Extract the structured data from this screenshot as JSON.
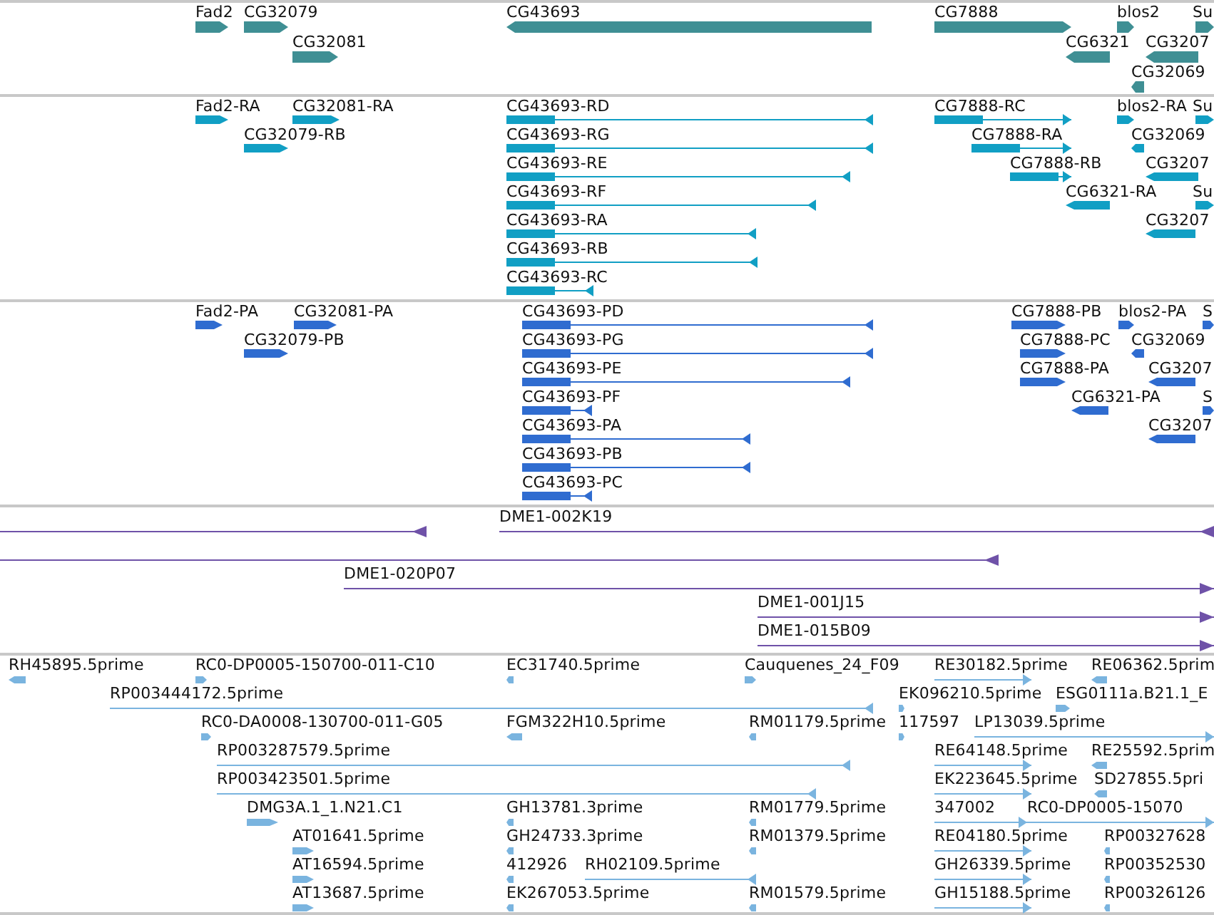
{
  "tracks": [
    {
      "kind": "gene",
      "features": [
        {
          "label": "Fad2",
          "reverse_strand": false
        },
        {
          "label": "CG32079",
          "reverse_strand": false
        },
        {
          "label": "CG32081",
          "reverse_strand": false
        },
        {
          "label": "CG43693",
          "reverse_strand": true
        },
        {
          "label": "CG7888",
          "reverse_strand": false
        },
        {
          "label": "blos2",
          "reverse_strand": false
        },
        {
          "label": "Su",
          "reverse_strand": false
        },
        {
          "label": "CG6321",
          "reverse_strand": true
        },
        {
          "label": "CG3207",
          "reverse_strand": true
        },
        {
          "label": "CG32069",
          "reverse_strand": true
        }
      ]
    },
    {
      "kind": "transcript",
      "features": [
        {
          "label": "Fad2-RA",
          "reverse_strand": false
        },
        {
          "label": "CG32081-RA",
          "reverse_strand": false
        },
        {
          "label": "CG32079-RB",
          "reverse_strand": false
        },
        {
          "label": "CG43693-RD",
          "reverse_strand": true
        },
        {
          "label": "CG43693-RG",
          "reverse_strand": true
        },
        {
          "label": "CG43693-RE",
          "reverse_strand": true
        },
        {
          "label": "CG43693-RF",
          "reverse_strand": true
        },
        {
          "label": "CG43693-RA",
          "reverse_strand": true
        },
        {
          "label": "CG43693-RB",
          "reverse_strand": true
        },
        {
          "label": "CG43693-RC",
          "reverse_strand": true
        },
        {
          "label": "CG7888-RC",
          "reverse_strand": false
        },
        {
          "label": "CG7888-RA",
          "reverse_strand": false
        },
        {
          "label": "CG7888-RB",
          "reverse_strand": false
        },
        {
          "label": "CG6321-RA",
          "reverse_strand": true
        },
        {
          "label": "blos2-RA",
          "reverse_strand": false
        },
        {
          "label": "Su",
          "reverse_strand": false
        },
        {
          "label": "CG32069",
          "reverse_strand": true
        },
        {
          "label": "CG3207",
          "reverse_strand": true
        },
        {
          "label": "Su",
          "reverse_strand": false
        },
        {
          "label": "CG3207",
          "reverse_strand": true
        }
      ]
    },
    {
      "kind": "protein",
      "features": [
        {
          "label": "Fad2-PA",
          "reverse_strand": false
        },
        {
          "label": "CG32081-PA",
          "reverse_strand": false
        },
        {
          "label": "CG32079-PB",
          "reverse_strand": false
        },
        {
          "label": "CG43693-PD",
          "reverse_strand": true
        },
        {
          "label": "CG43693-PG",
          "reverse_strand": true
        },
        {
          "label": "CG43693-PE",
          "reverse_strand": true
        },
        {
          "label": "CG43693-PF",
          "reverse_strand": true
        },
        {
          "label": "CG43693-PA",
          "reverse_strand": true
        },
        {
          "label": "CG43693-PB",
          "reverse_strand": true
        },
        {
          "label": "CG43693-PC",
          "reverse_strand": true
        },
        {
          "label": "CG7888-PB",
          "reverse_strand": false
        },
        {
          "label": "blos2-PA",
          "reverse_strand": false
        },
        {
          "label": "S",
          "reverse_strand": false
        },
        {
          "label": "CG7888-PC",
          "reverse_strand": false
        },
        {
          "label": "CG32069",
          "reverse_strand": true
        },
        {
          "label": "CG7888-PA",
          "reverse_strand": false
        },
        {
          "label": "CG3207",
          "reverse_strand": true
        },
        {
          "label": "CG6321-PA",
          "reverse_strand": true
        },
        {
          "label": "S",
          "reverse_strand": false
        },
        {
          "label": "CG3207",
          "reverse_strand": true
        }
      ]
    },
    {
      "kind": "clone",
      "features": [
        {
          "reverse_strand": true
        },
        {
          "label": "DME1-002K19",
          "reverse_strand": true
        },
        {
          "reverse_strand": true
        },
        {
          "label": "DME1-020P07",
          "reverse_strand": false
        },
        {
          "label": "DME1-001J15",
          "reverse_strand": false
        },
        {
          "label": "DME1-015B09",
          "reverse_strand": false
        }
      ]
    },
    {
      "kind": "est",
      "features": [
        {
          "label": "RH45895.5prime",
          "reverse_strand": true
        },
        {
          "label": "RC0-DP0005-150700-011-C10",
          "reverse_strand": false
        },
        {
          "label": "EC31740.5prime",
          "reverse_strand": true
        },
        {
          "label": "Cauquenes_24_F09",
          "reverse_strand": false
        },
        {
          "label": "RE30182.5prime",
          "reverse_strand": false
        },
        {
          "label": "RE06362.5prim",
          "reverse_strand": true
        },
        {
          "label": "RP003444172.5prime",
          "reverse_strand": true
        },
        {
          "label": "EK096210.5prime",
          "reverse_strand": false
        },
        {
          "label": "ESG0111a.B21.1_E",
          "reverse_strand": false
        },
        {
          "label": "RC0-DA0008-130700-011-G05",
          "reverse_strand": false
        },
        {
          "label": "FGM322H10.5prime",
          "reverse_strand": true
        },
        {
          "label": "RM01179.5prime",
          "reverse_strand": true
        },
        {
          "label": "117597",
          "reverse_strand": false
        },
        {
          "label": "LP13039.5prime",
          "reverse_strand": false
        },
        {
          "label": "RP003287579.5prime",
          "reverse_strand": true
        },
        {
          "label": "RE64148.5prime",
          "reverse_strand": false
        },
        {
          "label": "RE25592.5prim",
          "reverse_strand": true
        },
        {
          "label": "RP003423501.5prime",
          "reverse_strand": true
        },
        {
          "label": "EK223645.5prime",
          "reverse_strand": false
        },
        {
          "label": "SD27855.5pri",
          "reverse_strand": true
        },
        {
          "label": "DMG3A.1_1.N21.C1",
          "reverse_strand": false
        },
        {
          "label": "GH13781.3prime",
          "reverse_strand": true
        },
        {
          "label": "RM01779.5prime",
          "reverse_strand": true
        },
        {
          "label": "347002",
          "reverse_strand": false
        },
        {
          "label": "RC0-DP0005-15070",
          "reverse_strand": false
        },
        {
          "label": "AT01641.5prime",
          "reverse_strand": false
        },
        {
          "label": "GH24733.3prime",
          "reverse_strand": true
        },
        {
          "label": "RM01379.5prime",
          "reverse_strand": true
        },
        {
          "label": "RE04180.5prime",
          "reverse_strand": false
        },
        {
          "label": "RP00327628",
          "reverse_strand": true
        },
        {
          "label": "AT16594.5prime",
          "reverse_strand": false
        },
        {
          "label": "412926",
          "reverse_strand": true
        },
        {
          "label": "RH02109.5prime",
          "reverse_strand": true
        },
        {
          "label": "GH26339.5prime",
          "reverse_strand": false
        },
        {
          "label": "RP00352530",
          "reverse_strand": true
        },
        {
          "label": "AT13687.5prime",
          "reverse_strand": false
        },
        {
          "label": "EK267053.5prime",
          "reverse_strand": true
        },
        {
          "label": "RM01579.5prime",
          "reverse_strand": true
        },
        {
          "label": "GH15188.5prime",
          "reverse_strand": false
        },
        {
          "label": "RP00326126",
          "reverse_strand": true
        }
      ]
    }
  ]
}
